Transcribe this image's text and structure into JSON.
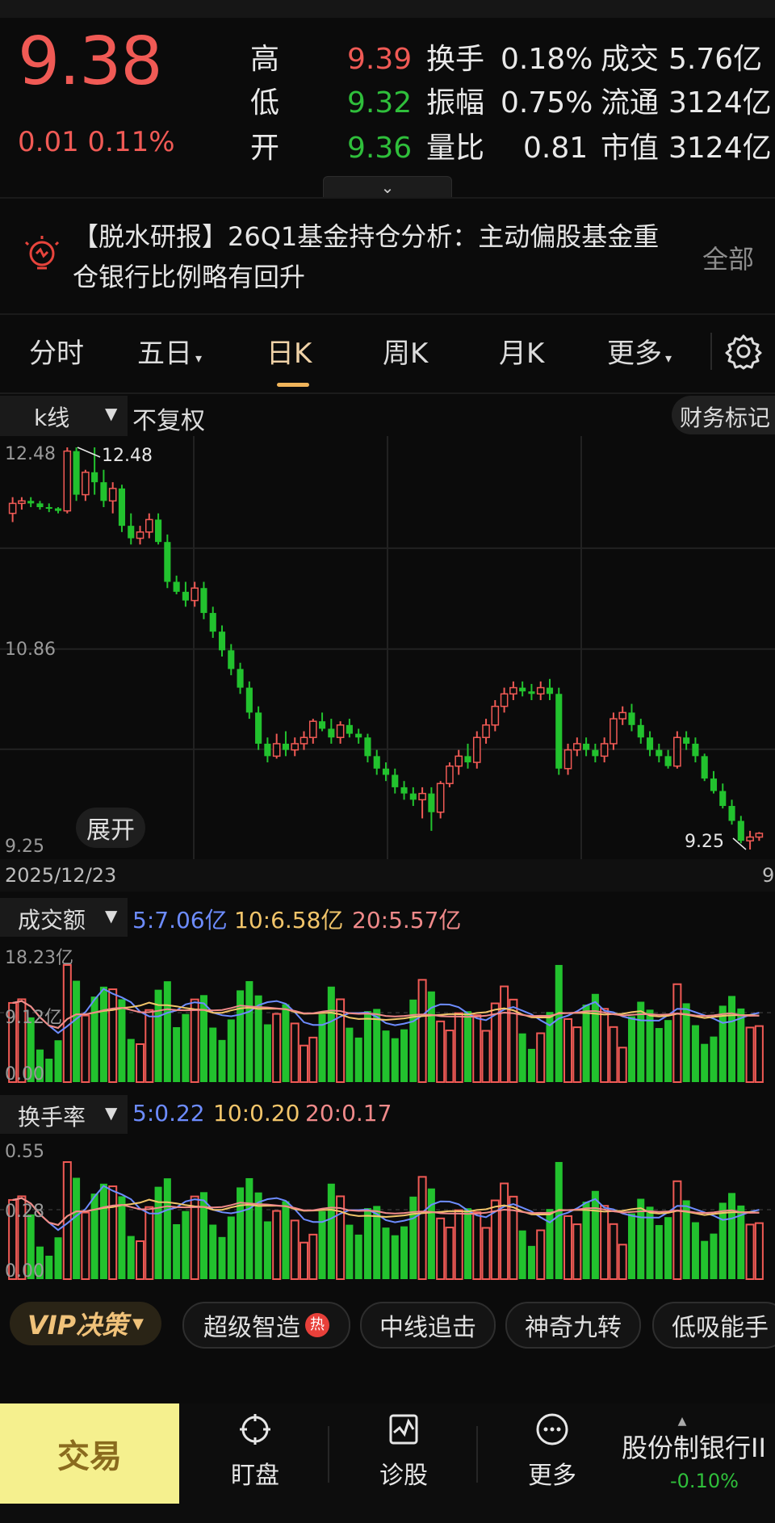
{
  "quote": {
    "price": "9.38",
    "change": "0.01",
    "change_pct": "0.11%",
    "high_label": "高",
    "high": "9.39",
    "low_label": "低",
    "low": "9.32",
    "open_label": "开",
    "open": "9.36",
    "turnover_label": "换手",
    "turnover": "0.18%",
    "amplitude_label": "振幅",
    "amplitude": "0.75%",
    "vol_ratio_label": "量比",
    "vol_ratio": "0.81",
    "amount_label": "成交",
    "amount": "5.76亿",
    "float_label": "流通",
    "float_cap": "3124亿",
    "mktcap_label": "市值",
    "mktcap": "3124亿"
  },
  "news": {
    "line1": "【脱水研报】26Q1基金持仓分析：主动偏股基金重",
    "line2": "仓银行比例略有回升",
    "all_label": "全部"
  },
  "tabs": [
    {
      "label": "分时"
    },
    {
      "label": "五日"
    },
    {
      "label": "日K"
    },
    {
      "label": "周K"
    },
    {
      "label": "月K"
    },
    {
      "label": "更多"
    }
  ],
  "chart_toolbar": {
    "kline_label": "k线",
    "fq_label": "不复权",
    "fin_mark_label": "财务标记"
  },
  "chart_data": {
    "type": "candlestick",
    "y_axis_labels": [
      "12.48",
      "10.86",
      "9.25"
    ],
    "max_label": "12.48",
    "min_label": "9.25",
    "start_date": "2025/12/23",
    "end_tick_partial": "9",
    "ylim": [
      9.25,
      12.48
    ],
    "candles": [
      [
        11.95,
        12.08,
        11.88,
        12.03
      ],
      [
        12.03,
        12.08,
        11.98,
        12.05
      ],
      [
        12.05,
        12.08,
        12.0,
        12.03
      ],
      [
        12.03,
        12.05,
        11.98,
        12.0
      ],
      [
        12.0,
        12.03,
        11.96,
        11.99
      ],
      [
        11.99,
        12.0,
        11.95,
        11.97
      ],
      [
        11.97,
        12.48,
        11.95,
        12.45
      ],
      [
        12.45,
        12.48,
        12.05,
        12.1
      ],
      [
        12.1,
        12.3,
        12.05,
        12.28
      ],
      [
        12.28,
        12.48,
        12.1,
        12.2
      ],
      [
        12.2,
        12.3,
        12.0,
        12.05
      ],
      [
        12.05,
        12.2,
        11.95,
        12.15
      ],
      [
        12.15,
        12.18,
        11.8,
        11.85
      ],
      [
        11.85,
        11.95,
        11.7,
        11.75
      ],
      [
        11.75,
        11.85,
        11.7,
        11.8
      ],
      [
        11.8,
        11.95,
        11.75,
        11.9
      ],
      [
        11.9,
        11.95,
        11.7,
        11.72
      ],
      [
        11.72,
        11.78,
        11.35,
        11.4
      ],
      [
        11.4,
        11.45,
        11.3,
        11.32
      ],
      [
        11.32,
        11.4,
        11.2,
        11.25
      ],
      [
        11.25,
        11.4,
        11.2,
        11.35
      ],
      [
        11.35,
        11.4,
        11.1,
        11.15
      ],
      [
        11.15,
        11.2,
        10.95,
        11.0
      ],
      [
        11.0,
        11.05,
        10.8,
        10.85
      ],
      [
        10.85,
        10.9,
        10.65,
        10.7
      ],
      [
        10.7,
        10.75,
        10.5,
        10.55
      ],
      [
        10.55,
        10.6,
        10.3,
        10.35
      ],
      [
        10.35,
        10.4,
        10.05,
        10.1
      ],
      [
        10.1,
        10.15,
        9.95,
        10.0
      ],
      [
        10.0,
        10.18,
        9.98,
        10.1
      ],
      [
        10.1,
        10.2,
        10.0,
        10.05
      ],
      [
        10.05,
        10.15,
        10.0,
        10.1
      ],
      [
        10.1,
        10.2,
        10.05,
        10.15
      ],
      [
        10.15,
        10.3,
        10.1,
        10.28
      ],
      [
        10.28,
        10.35,
        10.2,
        10.22
      ],
      [
        10.22,
        10.3,
        10.1,
        10.15
      ],
      [
        10.15,
        10.28,
        10.1,
        10.25
      ],
      [
        10.25,
        10.3,
        10.15,
        10.18
      ],
      [
        10.18,
        10.22,
        10.1,
        10.15
      ],
      [
        10.15,
        10.18,
        9.95,
        10.0
      ],
      [
        10.0,
        10.05,
        9.85,
        9.9
      ],
      [
        9.9,
        9.95,
        9.8,
        9.85
      ],
      [
        9.85,
        9.9,
        9.7,
        9.75
      ],
      [
        9.75,
        9.8,
        9.65,
        9.7
      ],
      [
        9.7,
        9.75,
        9.6,
        9.65
      ],
      [
        9.65,
        9.75,
        9.5,
        9.7
      ],
      [
        9.7,
        9.75,
        9.4,
        9.55
      ],
      [
        9.55,
        9.8,
        9.5,
        9.78
      ],
      [
        9.78,
        9.95,
        9.75,
        9.92
      ],
      [
        9.92,
        10.05,
        9.85,
        10.0
      ],
      [
        10.0,
        10.1,
        9.9,
        9.95
      ],
      [
        9.95,
        10.2,
        9.9,
        10.15
      ],
      [
        10.15,
        10.3,
        10.1,
        10.25
      ],
      [
        10.25,
        10.45,
        10.2,
        10.4
      ],
      [
        10.4,
        10.55,
        10.35,
        10.5
      ],
      [
        10.5,
        10.6,
        10.45,
        10.55
      ],
      [
        10.55,
        10.6,
        10.48,
        10.52
      ],
      [
        10.52,
        10.58,
        10.45,
        10.5
      ],
      [
        10.5,
        10.6,
        10.45,
        10.55
      ],
      [
        10.55,
        10.62,
        10.45,
        10.5
      ],
      [
        10.5,
        10.55,
        9.85,
        9.9
      ],
      [
        9.9,
        10.1,
        9.85,
        10.05
      ],
      [
        10.05,
        10.15,
        10.0,
        10.1
      ],
      [
        10.1,
        10.15,
        10.0,
        10.05
      ],
      [
        10.05,
        10.1,
        9.95,
        10.0
      ],
      [
        10.0,
        10.15,
        9.95,
        10.1
      ],
      [
        10.1,
        10.35,
        10.05,
        10.3
      ],
      [
        10.3,
        10.4,
        10.25,
        10.35
      ],
      [
        10.35,
        10.42,
        10.2,
        10.25
      ],
      [
        10.25,
        10.3,
        10.1,
        10.15
      ],
      [
        10.15,
        10.2,
        10.0,
        10.05
      ],
      [
        10.05,
        10.1,
        9.95,
        10.0
      ],
      [
        10.0,
        10.05,
        9.9,
        9.92
      ],
      [
        9.92,
        10.2,
        9.9,
        10.15
      ],
      [
        10.15,
        10.2,
        10.05,
        10.1
      ],
      [
        10.1,
        10.15,
        9.95,
        10.0
      ],
      [
        10.0,
        10.02,
        9.8,
        9.82
      ],
      [
        9.82,
        9.88,
        9.7,
        9.72
      ],
      [
        9.72,
        9.78,
        9.58,
        9.6
      ],
      [
        9.6,
        9.65,
        9.45,
        9.48
      ],
      [
        9.48,
        9.52,
        9.3,
        9.32
      ],
      [
        9.32,
        9.4,
        9.25,
        9.35
      ],
      [
        9.35,
        9.39,
        9.32,
        9.38
      ]
    ]
  },
  "volume_panel": {
    "title": "成交额",
    "ma5": "5:7.06亿",
    "ma10": "10:6.58亿",
    "ma20": "20:5.57亿",
    "top_label": "18.23亿",
    "mid_label": "9.12亿",
    "zero_label": "0.00",
    "max": 18.23
  },
  "turnover_panel": {
    "title": "换手率",
    "ma5": "5:0.22",
    "ma10": "10:0.20",
    "ma20": "20:0.17",
    "top_label": "0.55",
    "mid_label": "0.28",
    "zero_label": "0.00",
    "max": 0.55
  },
  "colors": {
    "up": "#f05a55",
    "down": "#22c22e",
    "ma5": "#6d8cff",
    "ma10": "#f2c56a",
    "ma20": "#f08a8a"
  },
  "chips": {
    "vip": "VIP决策",
    "c1": "超级智造",
    "hot": "热",
    "c2": "中线追击",
    "c3": "神奇九转",
    "c4": "低吸能手"
  },
  "bottom_nav": {
    "trade": "交易",
    "watch": "盯盘",
    "diagnose": "诊股",
    "more": "更多",
    "sector_name": "股份制银行II",
    "sector_change": "-0.10%"
  }
}
